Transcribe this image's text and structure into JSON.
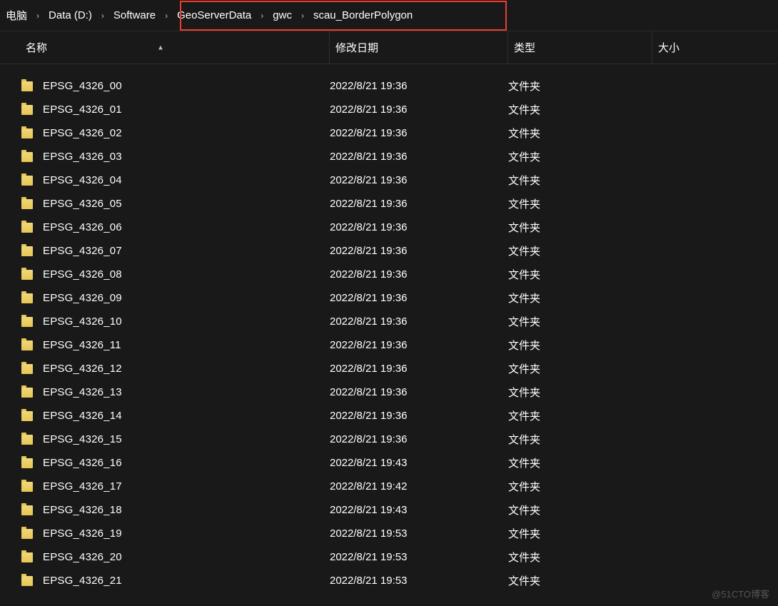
{
  "breadcrumb": [
    {
      "label": "电脑"
    },
    {
      "label": "Data (D:)"
    },
    {
      "label": "Software"
    },
    {
      "label": "GeoServerData"
    },
    {
      "label": "gwc"
    },
    {
      "label": "scau_BorderPolygon"
    }
  ],
  "columns": {
    "name": "名称",
    "date": "修改日期",
    "type": "类型",
    "size": "大小"
  },
  "sort_indicator": "▲",
  "chevron": "›",
  "folder_type_label": "文件夹",
  "watermark": "@51CTO博客",
  "rows": [
    {
      "name": "EPSG_4326_00",
      "date": "2022/8/21 19:36"
    },
    {
      "name": "EPSG_4326_01",
      "date": "2022/8/21 19:36"
    },
    {
      "name": "EPSG_4326_02",
      "date": "2022/8/21 19:36"
    },
    {
      "name": "EPSG_4326_03",
      "date": "2022/8/21 19:36"
    },
    {
      "name": "EPSG_4326_04",
      "date": "2022/8/21 19:36"
    },
    {
      "name": "EPSG_4326_05",
      "date": "2022/8/21 19:36"
    },
    {
      "name": "EPSG_4326_06",
      "date": "2022/8/21 19:36"
    },
    {
      "name": "EPSG_4326_07",
      "date": "2022/8/21 19:36"
    },
    {
      "name": "EPSG_4326_08",
      "date": "2022/8/21 19:36"
    },
    {
      "name": "EPSG_4326_09",
      "date": "2022/8/21 19:36"
    },
    {
      "name": "EPSG_4326_10",
      "date": "2022/8/21 19:36"
    },
    {
      "name": "EPSG_4326_11",
      "date": "2022/8/21 19:36"
    },
    {
      "name": "EPSG_4326_12",
      "date": "2022/8/21 19:36"
    },
    {
      "name": "EPSG_4326_13",
      "date": "2022/8/21 19:36"
    },
    {
      "name": "EPSG_4326_14",
      "date": "2022/8/21 19:36"
    },
    {
      "name": "EPSG_4326_15",
      "date": "2022/8/21 19:36"
    },
    {
      "name": "EPSG_4326_16",
      "date": "2022/8/21 19:43"
    },
    {
      "name": "EPSG_4326_17",
      "date": "2022/8/21 19:42"
    },
    {
      "name": "EPSG_4326_18",
      "date": "2022/8/21 19:43"
    },
    {
      "name": "EPSG_4326_19",
      "date": "2022/8/21 19:53"
    },
    {
      "name": "EPSG_4326_20",
      "date": "2022/8/21 19:53"
    },
    {
      "name": "EPSG_4326_21",
      "date": "2022/8/21 19:53"
    }
  ]
}
